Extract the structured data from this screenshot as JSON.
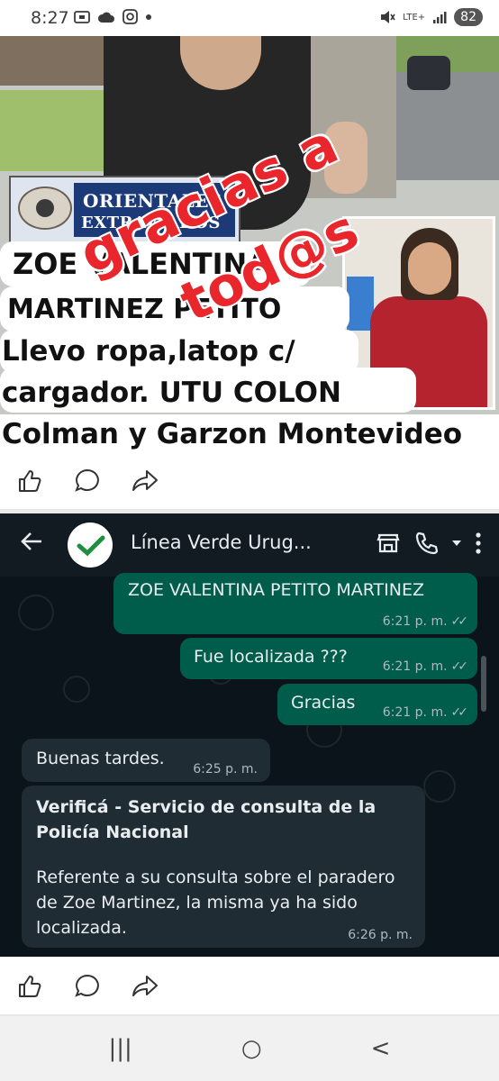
{
  "status_bar": {
    "time": "8:27",
    "network": "LTE+",
    "battery": "82",
    "icons": [
      "screenshot-icon",
      "cloud-icon",
      "instagram-icon",
      "dot-icon",
      "mute-icon",
      "signal-icon"
    ]
  },
  "post1": {
    "overlay_line1": "gracias a",
    "overlay_line2": "tod@s",
    "logo_line1": "ORIENTALES",
    "logo_line2": "EXTRAVIADOS",
    "caption_line1": "ZOE VALENTINA",
    "caption_line2": "MARTINEZ PETITO",
    "caption_line3": "Llevo ropa,latop c/",
    "caption_line4": "cargador.  UTU  COLON",
    "caption_line5": "Colman y Garzon  Montevideo",
    "actions": [
      "like-icon",
      "comment-icon",
      "share-icon"
    ]
  },
  "chat": {
    "contact_name": "Línea Verde Urug...",
    "messages": [
      {
        "dir": "out",
        "text": "ZOE VALENTINA PETITO MARTINEZ",
        "time": "6:21 p. m."
      },
      {
        "dir": "out",
        "text": "Fue localizada ???",
        "time": "6:21 p. m."
      },
      {
        "dir": "out",
        "text": "Gracias",
        "time": "6:21 p. m."
      },
      {
        "dir": "in",
        "text": "Buenas tardes.",
        "time": "6:25 p. m."
      },
      {
        "dir": "in",
        "title": "Verificá - Servicio de consulta de la Policía Nacional",
        "text": "Referente a su consulta sobre el paradero de Zoe Martinez, la misma ya ha sido localizada.",
        "time": "6:26 p. m."
      }
    ],
    "colors": {
      "header": "#111b21",
      "background": "#0b141a",
      "outgoing": "#005c4b",
      "incoming": "#1f2c33"
    }
  },
  "nav": {
    "recent": "|||",
    "home": "○",
    "back": "<"
  }
}
